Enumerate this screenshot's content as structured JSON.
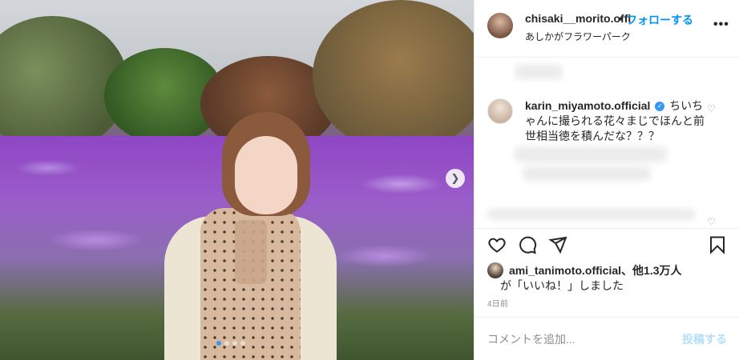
{
  "post": {
    "account": {
      "username": "chisaki__morito.offi",
      "separator": "•",
      "follow_label": "フォローする",
      "location": "あしかがフラワーパーク",
      "more_label": "•••"
    },
    "carousel": {
      "next_icon": "chevron-right-icon",
      "slide_count": 4,
      "current_slide": 1
    },
    "comments": [
      {
        "username": "karin_miyamoto.official",
        "verified": true,
        "text": "ちいちゃんに撮られる花々まじでほんと前世相当徳を積んだな？？？"
      }
    ],
    "actions": {
      "like_icon": "heart-icon",
      "comment_icon": "comment-bubble-icon",
      "share_icon": "paper-plane-icon",
      "save_icon": "bookmark-icon"
    },
    "likes": {
      "user": "ami_tanimoto.official",
      "others": "、他1.3万人",
      "suffix": "が「いいね！」しました"
    },
    "date": "4日前",
    "add_comment": {
      "placeholder": "コメントを追加...",
      "post_label": "投稿する"
    },
    "colors": {
      "accent": "#0095f6",
      "post_disabled": "#b2dffc",
      "verified": "#3897f0"
    }
  }
}
